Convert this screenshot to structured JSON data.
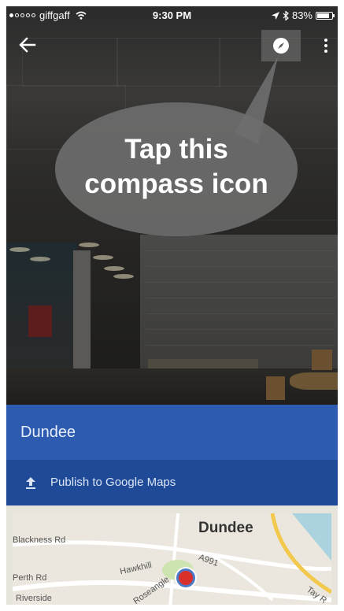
{
  "status_bar": {
    "carrier": "giffgaff",
    "time": "9:30 PM",
    "battery": "83%"
  },
  "toolbar": {
    "back_icon": "arrow-left-icon",
    "compass_icon": "compass-icon",
    "more_icon": "more-vert-icon"
  },
  "callout": {
    "text": "Tap this\ncompass icon"
  },
  "place": {
    "title": "Dundee",
    "publish_label": "Publish to Google Maps",
    "publish_icon": "upload-icon"
  },
  "map": {
    "city": "Dundee",
    "roads": [
      "Blackness Rd",
      "Hawkhill",
      "A991",
      "Perth Rd",
      "Riverside",
      "Roseangle",
      "Tay R"
    ]
  },
  "colors": {
    "header_blue": "#2c5bb0",
    "publish_blue": "#1e4a97",
    "pin_red": "#d9302c"
  }
}
